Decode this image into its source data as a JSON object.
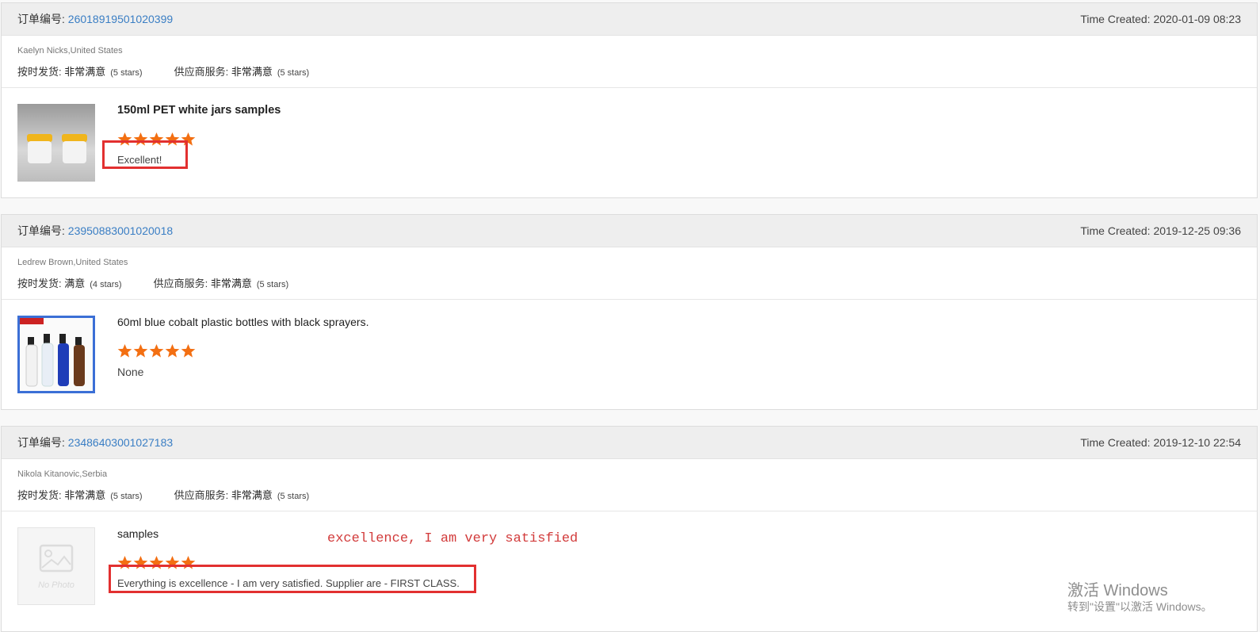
{
  "labels": {
    "order_no": "订单编号: ",
    "time_created": "Time Created: ",
    "ontime": "按时发货: ",
    "service": "供应商服务: "
  },
  "orders": [
    {
      "order_no": "26018919501020399",
      "time": "2020-01-09 08:23",
      "buyer": "Kaelyn Nicks,United States",
      "ontime_rating": "非常满意",
      "ontime_stars": "(5 stars)",
      "service_rating": "非常满意",
      "service_stars": "(5 stars)",
      "product_name": "150ml PET white jars samples",
      "rating_stars": 5,
      "review": "Excellent!"
    },
    {
      "order_no": "23950883001020018",
      "time": "2019-12-25 09:36",
      "buyer": "Ledrew Brown,United States",
      "ontime_rating": "满意",
      "ontime_stars": "(4 stars)",
      "service_rating": "非常满意",
      "service_stars": "(5 stars)",
      "product_name": "60ml blue cobalt plastic bottles with black sprayers.",
      "rating_stars": 5,
      "review": "None"
    },
    {
      "order_no": "23486403001027183",
      "time": "2019-12-10 22:54",
      "buyer": "Nikola Kitanovic,Serbia",
      "ontime_rating": "非常满意",
      "ontime_stars": "(5 stars)",
      "service_rating": "非常满意",
      "service_stars": "(5 stars)",
      "product_name": "samples",
      "rating_stars": 5,
      "review": "Everything is excellence - I am very satisfied. Supplier are - FIRST CLASS.",
      "no_photo": "No Photo"
    }
  ],
  "annotation": "excellence, I am very satisfied",
  "watermark": {
    "line1": "激活 Windows",
    "line2": "转到\"设置\"以激活 Windows。"
  },
  "colors": {
    "link": "#3a7ec4",
    "star": "#f36f12",
    "highlight": "#e23030"
  }
}
